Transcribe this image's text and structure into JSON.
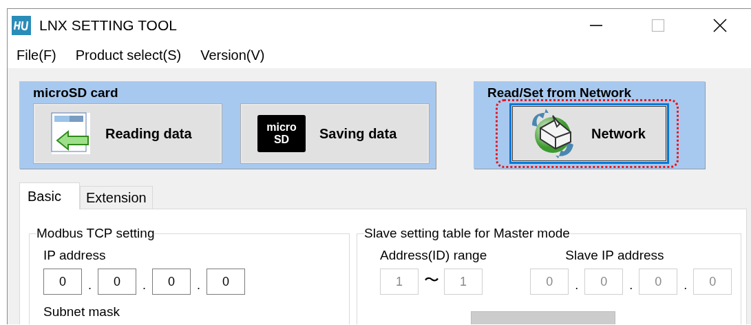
{
  "window": {
    "title": "LNX SETTING TOOL"
  },
  "menu": [
    {
      "label": "File(F)"
    },
    {
      "label": "Product select(S)"
    },
    {
      "label": "Version(V)"
    }
  ],
  "panels": [
    {
      "title": "microSD card",
      "buttons": [
        {
          "label": "Reading data",
          "kind": "read",
          "focused": false,
          "highlighted": false
        },
        {
          "label": "Saving data",
          "kind": "microsd",
          "icon_lines": [
            "micro",
            "SD"
          ],
          "focused": false,
          "highlighted": false
        }
      ]
    },
    {
      "title": "Read/Set from Network",
      "buttons": [
        {
          "label": "Network",
          "kind": "network",
          "focused": true,
          "highlighted": true
        }
      ]
    }
  ],
  "tabs": [
    {
      "label": "Basic",
      "selected": true
    },
    {
      "label": "Extension",
      "selected": false
    }
  ],
  "modbus": {
    "title": "Modbus TCP setting",
    "ip_label": "IP address",
    "ip": {
      "octets": [
        "0",
        "0",
        "0",
        "0"
      ],
      "separators": [
        ".",
        ".",
        "."
      ],
      "disabled": false
    },
    "subnet_label": "Subnet mask"
  },
  "slave": {
    "title": "Slave setting table for Master mode",
    "range_label": "Address(ID) range",
    "range_from": "1",
    "range_separator": "〜",
    "range_to": "1",
    "range_disabled": true,
    "ip_label": "Slave IP address",
    "ip": {
      "octets": [
        "0",
        "0",
        "0",
        "0"
      ],
      "separators": [
        ".",
        ".",
        "."
      ],
      "disabled": true
    },
    "action_button": {
      "disabled": true
    }
  }
}
